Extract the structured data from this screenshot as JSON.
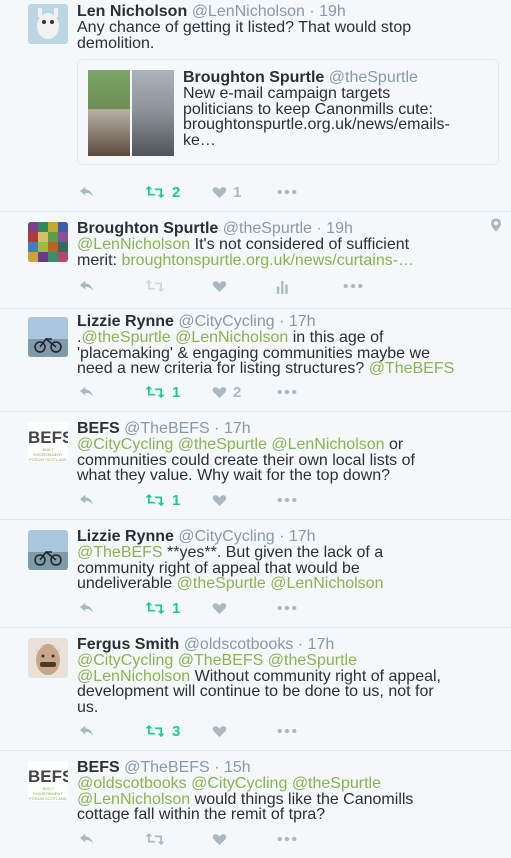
{
  "colors": {
    "accent": "#8ab34e",
    "retweet": "#19cf86",
    "muted": "#aab8c2",
    "text": "#292f33"
  },
  "tweets": [
    {
      "name": "Len Nicholson",
      "handle": "@LenNicholson",
      "time": "19h",
      "text": "Any chance of getting it listed? That would stop demolition.",
      "quote": {
        "name": "Broughton Spurtle",
        "handle": "@theSpurtle",
        "text1": "New e-mail campaign targets",
        "text2": "politicians to keep Canonmills cute:",
        "text3": "broughtonspurtle.org.uk/news/emails-",
        "text4": "ke…"
      },
      "retweets": "2",
      "likes": "1"
    },
    {
      "name": "Broughton Spurtle",
      "handle": "@theSpurtle",
      "time": "19h",
      "mention1": "@LenNicholson",
      "text1": " It's not considered of sufficient",
      "text2": "merit: ",
      "link": "broughtonspurtle.org.uk/news/curtains-…"
    },
    {
      "name": "Lizzie Rynne",
      "handle": "@CityCycling",
      "time": "17h",
      "pre": ".",
      "mention1": "@theSpurtle",
      "mention2": "@LenNicholson",
      "text1": " in this age of",
      "text2": "'placemaking' & engaging communities maybe we",
      "text3": "need a new criteria for listing structures? ",
      "mention3": "@TheBEFS",
      "retweets": "1",
      "likes": "2"
    },
    {
      "name": "BEFS",
      "handle": "@TheBEFS",
      "time": "17h",
      "mention1": "@CityCycling",
      "mention2": "@theSpurtle",
      "mention3": "@LenNicholson",
      "text1": " or",
      "text2": "communities could create their own local lists of",
      "text3": "what they value. Why wait for the top down?",
      "retweets": "1",
      "logo": "BEFS",
      "logo_sub1": "BUILT ENVIRONMENT",
      "logo_sub2": "FORUM SCOTLAND"
    },
    {
      "name": "Lizzie Rynne",
      "handle": "@CityCycling",
      "time": "17h",
      "mention1": "@TheBEFS",
      "text1": " **yes**. But given the lack of a",
      "text2": "community right of appeal that would be",
      "text3": "undeliverable ",
      "mention2": "@theSpurtle",
      "mention3": "@LenNicholson",
      "retweets": "1"
    },
    {
      "name": "Fergus Smith",
      "handle": "@oldscotbooks",
      "time": "17h",
      "mention1": "@CityCycling",
      "mention2": "@TheBEFS",
      "mention3": "@theSpurtle",
      "mention4": "@LenNicholson",
      "text1": " Without community right of appeal,",
      "text2": "development will continue to be done to us, not for",
      "text3": "us.",
      "retweets": "3"
    },
    {
      "name": "BEFS",
      "handle": "@TheBEFS",
      "time": "15h",
      "mention1": "@oldscotbooks",
      "mention2": "@CityCycling",
      "mention3": "@theSpurtle",
      "mention4": "@LenNicholson",
      "text1": " would things like the Canomills",
      "text2": "cottage fall within the remit of tpra?",
      "logo": "BEFS",
      "logo_sub1": "BUILT ENVIRONMENT",
      "logo_sub2": "FORUM SCOTLAND"
    }
  ],
  "separator": " · "
}
